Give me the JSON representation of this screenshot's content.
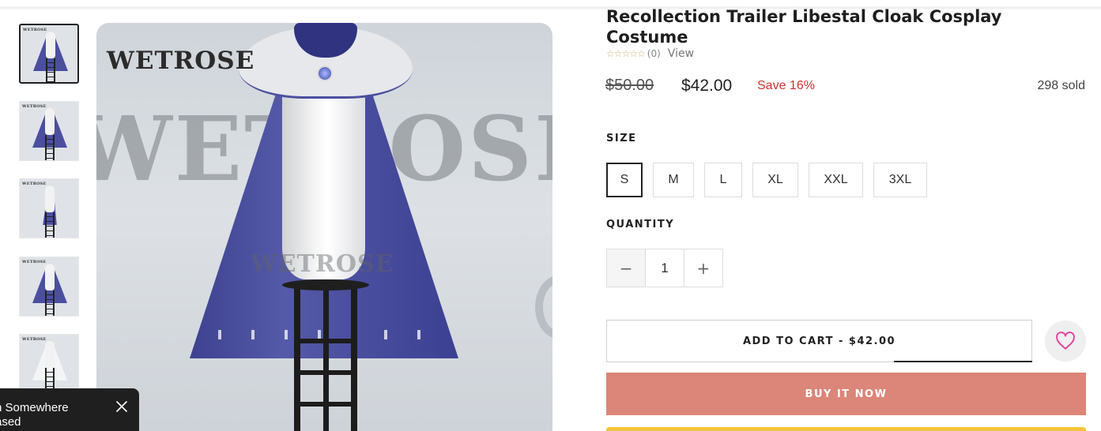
{
  "gallery": {
    "brand_watermark": "WETROSE",
    "thumbnails": [
      {
        "name": "thumbnail-1",
        "variant": "blue-cape",
        "active": true
      },
      {
        "name": "thumbnail-2",
        "variant": "blue-cape",
        "active": false
      },
      {
        "name": "thumbnail-3",
        "variant": "blue-cape",
        "active": false
      },
      {
        "name": "thumbnail-4",
        "variant": "blue-cape",
        "active": false
      },
      {
        "name": "thumbnail-5",
        "variant": "white-cape",
        "active": false
      }
    ]
  },
  "product": {
    "title": "Recollection Trailer Libestal Cloak Cosplay Costume",
    "rating_stars": "☆☆☆☆☆",
    "rating_count": "(0)",
    "view_label": "View",
    "price_compare": "$50.00",
    "price": "$42.00",
    "save": "Save 16%",
    "sold": "298 sold"
  },
  "options": {
    "size_label": "SIZE",
    "sizes": [
      "S",
      "M",
      "L",
      "XL",
      "XXL",
      "3XL"
    ],
    "selected_size": "S",
    "quantity_label": "QUANTITY",
    "quantity": "1",
    "minus_symbol": "−",
    "plus_symbol": "+"
  },
  "actions": {
    "add_to_cart": "ADD TO CART - $42.00",
    "buy_now": "BUY IT NOW",
    "wishlist_icon": "heart-icon"
  },
  "toast": {
    "text": "n Somewhere\nased"
  },
  "colors": {
    "buy_now": "#db8678",
    "save_red": "#d03030",
    "wishlist_heart": "#e0449a",
    "yellow_button": "#f3c53a"
  }
}
